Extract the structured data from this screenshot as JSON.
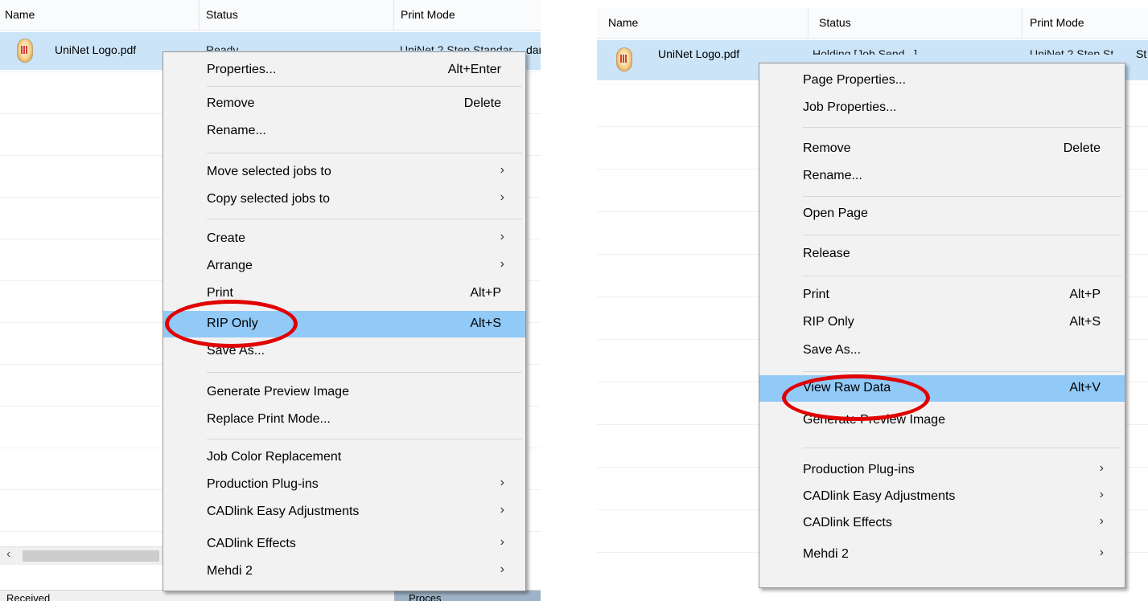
{
  "left": {
    "columns": {
      "name": "Name",
      "status": "Status",
      "print_mode": "Print Mode"
    },
    "job": {
      "name": "UniNet Logo.pdf",
      "status_partial": "Ready",
      "print_mode_partial": "UniNet 2 Step Standar",
      "edge_tail": "dar"
    },
    "status_bar": {
      "left": "Received",
      "right": "Proces"
    },
    "menu": [
      {
        "label": "Properties...",
        "shortcut": "Alt+Enter"
      },
      {
        "label": "Remove",
        "shortcut": "Delete"
      },
      {
        "label": "Rename..."
      },
      {
        "label": "Move selected jobs to",
        "submenu": true
      },
      {
        "label": "Copy selected jobs to",
        "submenu": true
      },
      {
        "label": "Create",
        "submenu": true
      },
      {
        "label": "Arrange",
        "submenu": true
      },
      {
        "label": "Print",
        "shortcut": "Alt+P"
      },
      {
        "label": "RIP Only",
        "shortcut": "Alt+S",
        "highlighted": true
      },
      {
        "label": "Save As..."
      },
      {
        "label": "Generate Preview Image"
      },
      {
        "label": "Replace Print Mode..."
      },
      {
        "label": "Job Color Replacement"
      },
      {
        "label": "Production Plug-ins",
        "submenu": true
      },
      {
        "label": "CADlink Easy Adjustments",
        "submenu": true
      },
      {
        "label": "CADlink Effects",
        "submenu": true
      },
      {
        "label": "Mehdi 2",
        "submenu": true
      }
    ]
  },
  "right": {
    "columns": {
      "name": "Name",
      "status": "Status",
      "print_mode": "Print Mode"
    },
    "job": {
      "name": "UniNet Logo.pdf",
      "status_partial": "Holding [Job Send...]",
      "print_mode_partial": "UniNet 2 Step St",
      "edge_tail": "St"
    },
    "menu": [
      {
        "label": "Page Properties..."
      },
      {
        "label": "Job Properties..."
      },
      {
        "label": "Remove",
        "shortcut": "Delete"
      },
      {
        "label": "Rename..."
      },
      {
        "label": "Open Page"
      },
      {
        "label": "Release"
      },
      {
        "label": "Print",
        "shortcut": "Alt+P"
      },
      {
        "label": "RIP Only",
        "shortcut": "Alt+S"
      },
      {
        "label": "Save As..."
      },
      {
        "label": "View Raw Data",
        "shortcut": "Alt+V",
        "highlighted": true
      },
      {
        "label": "Generate Preview Image"
      },
      {
        "label": "Production Plug-ins",
        "submenu": true
      },
      {
        "label": "CADlink Easy Adjustments",
        "submenu": true
      },
      {
        "label": "CADlink Effects",
        "submenu": true
      },
      {
        "label": "Mehdi 2",
        "submenu": true
      }
    ]
  },
  "icons": {
    "file": "pdf-logo-icon",
    "submenu": "chevron-right-icon",
    "scroll_left": "chevron-left-icon"
  },
  "colors": {
    "highlight": "#91c9f7",
    "selected_row": "#cce4f7",
    "annotation": "#e10000",
    "menu_bg": "#f2f2f2"
  },
  "glyphs": {
    "chevron": "›",
    "chevron_left": "‹"
  }
}
